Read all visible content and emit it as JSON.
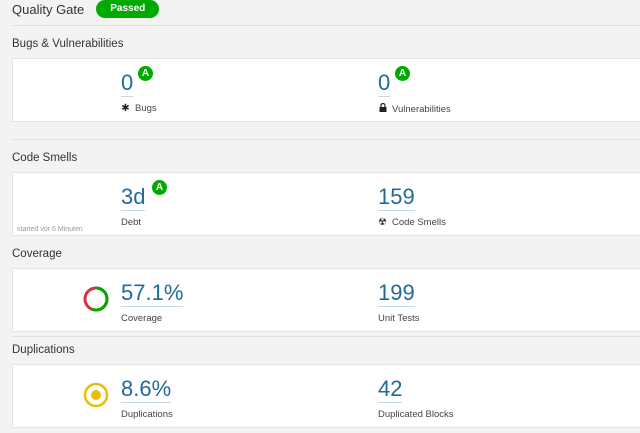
{
  "quality_gate": {
    "title": "Quality Gate",
    "status": "Passed",
    "status_color": "#00aa00"
  },
  "bugs_vulns": {
    "title": "Bugs & Vulnerabilities",
    "bugs": {
      "value": "0",
      "grade": "A",
      "label": "Bugs",
      "icon": "bug-icon"
    },
    "vulnerabilities": {
      "value": "0",
      "grade": "A",
      "label": "Vulnerabilities",
      "icon": "lock-icon"
    }
  },
  "code_smells": {
    "title": "Code Smells",
    "debt": {
      "value": "3d",
      "grade": "A",
      "label": "Debt"
    },
    "smells": {
      "value": "159",
      "label": "Code Smells",
      "icon": "radiation-icon"
    },
    "started": "started vor 6 Minuten"
  },
  "coverage": {
    "title": "Coverage",
    "coverage": {
      "value": "57.1%",
      "label": "Coverage",
      "fraction": 0.571
    },
    "tests": {
      "value": "199",
      "label": "Unit Tests"
    }
  },
  "duplications": {
    "title": "Duplications",
    "duplications": {
      "value": "8.6%",
      "label": "Duplications"
    },
    "blocks": {
      "value": "42",
      "label": "Duplicated Blocks"
    }
  },
  "colors": {
    "pass": "#00aa00",
    "value": "#236a97",
    "coverage_good": "#00aa00",
    "coverage_bad": "#d4333f",
    "dup_ring": "#eabe06"
  }
}
